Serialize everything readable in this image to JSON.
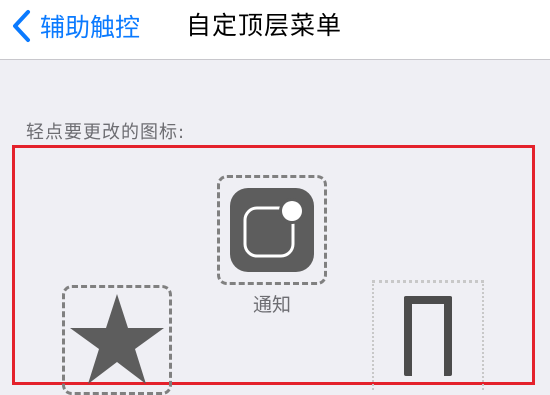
{
  "nav": {
    "back_label": "辅助触控",
    "title": "自定顶层菜单"
  },
  "hint": "轻点要更改的图标:",
  "icons": [
    {
      "name": "notification-icon",
      "label": "通知"
    },
    {
      "name": "star-icon",
      "label": ""
    },
    {
      "name": "empty-slot",
      "label": ""
    }
  ],
  "colors": {
    "accent": "#0a7aff",
    "highlight_frame": "#e4212b",
    "icon_fill": "#5d5d5d",
    "background": "#efeff4"
  }
}
